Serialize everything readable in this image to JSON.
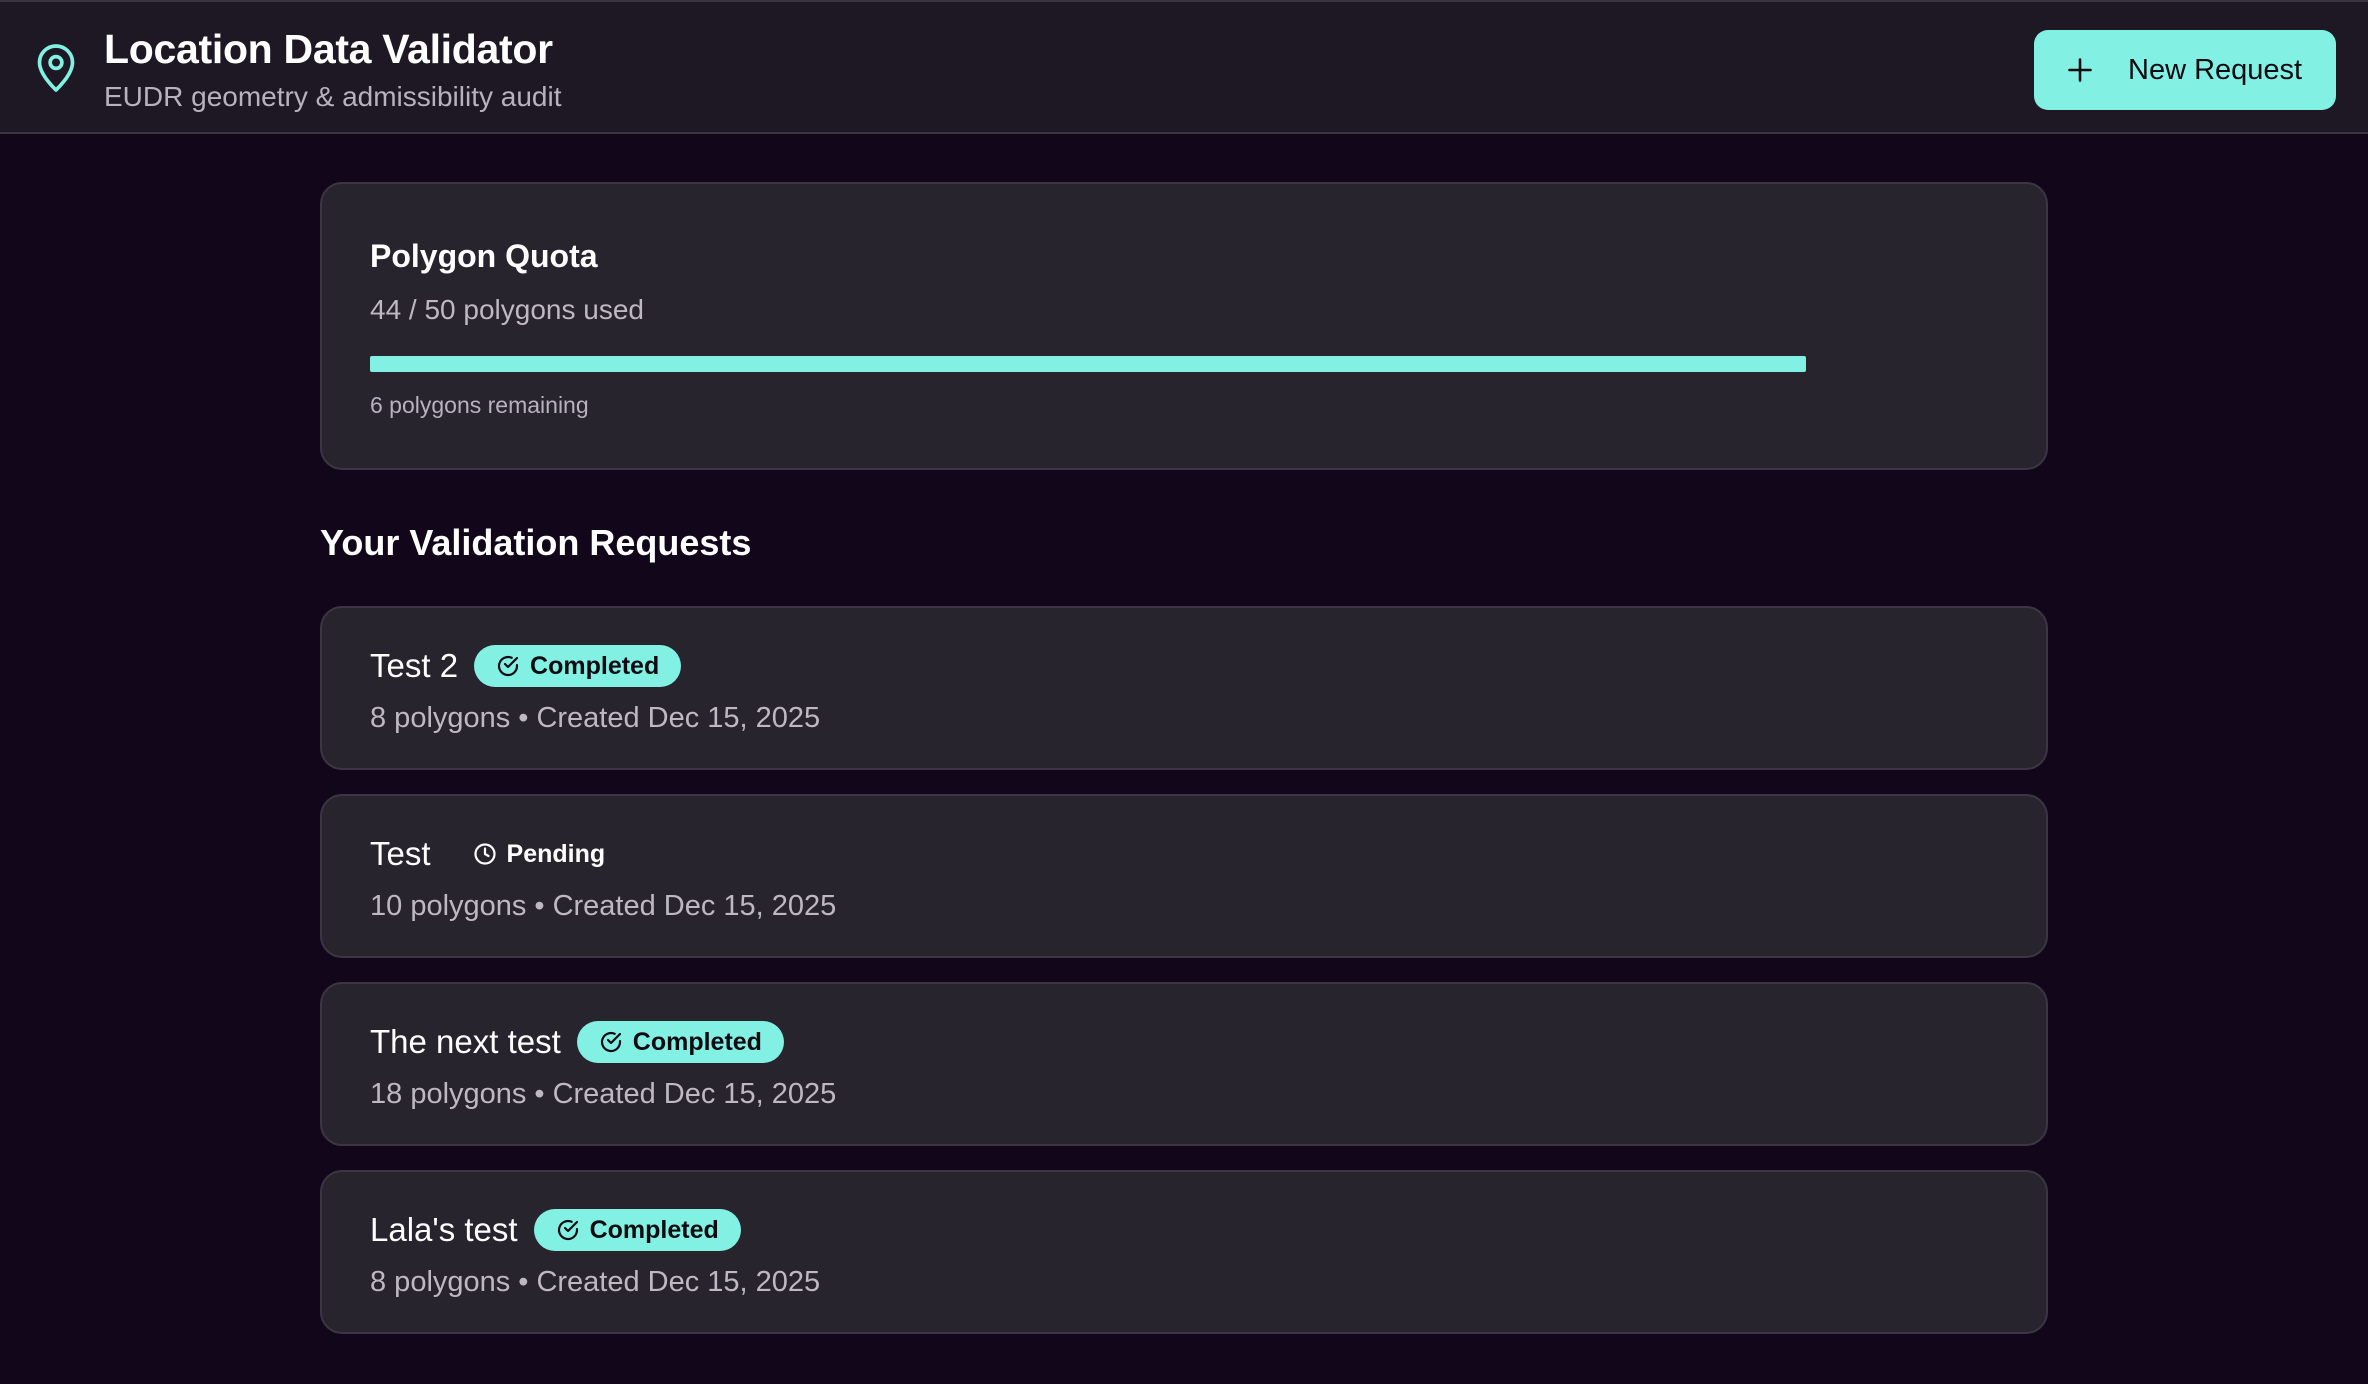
{
  "header": {
    "title": "Location Data Validator",
    "subtitle": "EUDR geometry & admissibility audit",
    "logo_icon": "map-pin-icon",
    "new_request_label": "New Request",
    "new_request_icon": "plus-icon"
  },
  "quota": {
    "title": "Polygon Quota",
    "used_text": "44 / 50 polygons used",
    "used": 44,
    "total": 50,
    "progress_fraction": 0.88,
    "remaining_text": "6 polygons remaining"
  },
  "requests_section": {
    "title": "Your Validation Requests",
    "items": [
      {
        "name": "Test 2",
        "status": "Completed",
        "status_icon": "check-circle-icon",
        "polygons": "8 polygons",
        "created": "Created Dec 15, 2025"
      },
      {
        "name": "Test",
        "status": "Pending",
        "status_icon": "clock-icon",
        "polygons": "10 polygons",
        "created": "Created Dec 15, 2025"
      },
      {
        "name": "The next test",
        "status": "Completed",
        "status_icon": "check-circle-icon",
        "polygons": "18 polygons",
        "created": "Created Dec 15, 2025"
      },
      {
        "name": "Lala's test",
        "status": "Completed",
        "status_icon": "check-circle-icon",
        "polygons": "8 polygons",
        "created": "Created Dec 15, 2025"
      }
    ]
  },
  "colors": {
    "background": "#12071a",
    "header_background": "#1d1823",
    "card_background": "#28242e",
    "accent": "#82f1e4",
    "muted_text": "#bdb8c2"
  }
}
